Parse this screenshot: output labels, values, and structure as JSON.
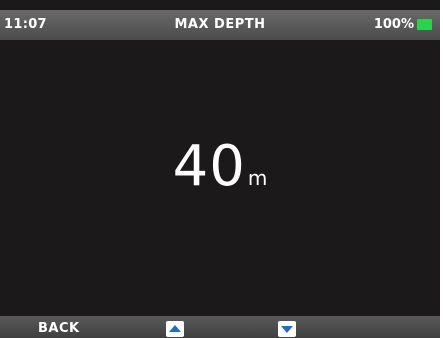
{
  "status": {
    "time": "11:07",
    "title": "MAX DEPTH",
    "battery": "100%"
  },
  "main": {
    "value": "40",
    "unit": "m"
  },
  "footer": {
    "back_label": "BACK",
    "up_icon": "up-arrow-icon",
    "down_icon": "down-arrow-icon"
  },
  "colors": {
    "background": "#1b191a",
    "accent_blue": "#1f6ec6",
    "battery_green": "#2bd24a"
  }
}
